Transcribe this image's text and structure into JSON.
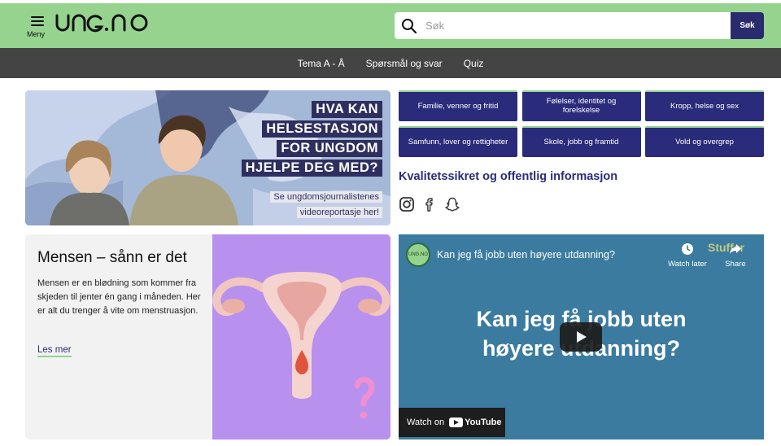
{
  "header": {
    "menu_label": "Meny",
    "logo": "UNG.NO",
    "search_placeholder": "Søk",
    "search_button": "Søk"
  },
  "nav": {
    "items": [
      "Tema A - Å",
      "Spørsmål og svar",
      "Quiz"
    ]
  },
  "hero": {
    "headline": [
      "HVA KAN",
      "HELSESTASJON",
      "FOR UNGDOM",
      "HJELPE DEG MED?"
    ],
    "subline": [
      "Se ungdomsjournalistenes",
      "videoreportasje her!"
    ]
  },
  "categories": [
    "Familie, venner og fritid",
    "Følelser, identitet og forelskelse",
    "Kropp, helse og sex",
    "Samfunn, lover og rettigheter",
    "Skole, jobb og framtid",
    "Vold og overgrep"
  ],
  "quality_heading": "Kvalitetssikret og offentlig informasjon",
  "socials": [
    "instagram-icon",
    "facebook-icon",
    "snapchat-icon"
  ],
  "article": {
    "title": "Mensen – sånn er det",
    "body": "Mensen er en blødning som kommer fra skjeden til jenter én gang i måneden. Her er alt du trenger å vite om menstruasjon.",
    "link": "Les mer"
  },
  "video": {
    "channel_avatar": "UNG.NO",
    "title": "Kan jeg få jobb uten høyere utdanning?",
    "watch_later": "Watch later",
    "share": "Share",
    "brand": "Stuffer",
    "overlay_text": [
      "Kan jeg få jobb uten",
      "høyere utdanning?"
    ],
    "watch_on": "Watch on",
    "youtube": "YouTube"
  },
  "colors": {
    "header_green": "#95d38f",
    "nav_gray": "#444444",
    "navy": "#2a2b7b",
    "card_purple": "#b890ee",
    "video_blue": "#3b7ba0"
  }
}
